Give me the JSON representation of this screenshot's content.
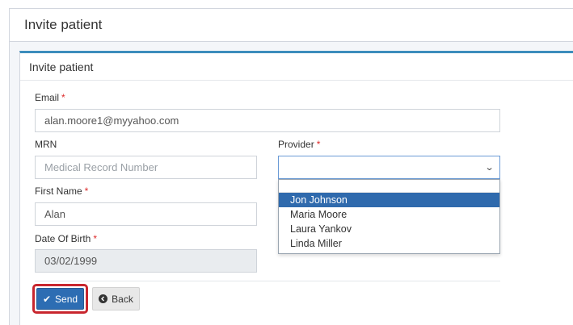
{
  "page": {
    "title": "Invite patient"
  },
  "panel": {
    "title": "Invite patient"
  },
  "form": {
    "email": {
      "label": "Email",
      "required_mark": "*",
      "value": "alan.moore1@myyahoo.com"
    },
    "mrn": {
      "label": "MRN",
      "placeholder": "Medical Record Number"
    },
    "provider": {
      "label": "Provider",
      "required_mark": "*",
      "value": "",
      "options": [
        "Jon Johnson",
        "Maria Moore",
        "Laura Yankov",
        "Linda Miller"
      ],
      "highlighted_option": "Jon Johnson"
    },
    "first_name": {
      "label": "First Name",
      "required_mark": "*",
      "value": "Alan"
    },
    "dob": {
      "label": "Date Of Birth",
      "required_mark": "*",
      "value": "03/02/1999"
    }
  },
  "actions": {
    "send_label": "Send",
    "back_label": "Back"
  },
  "colors": {
    "accent": "#2d6db3",
    "required": "#dd2c2c",
    "highlight_border": "#c8262e",
    "selected_option": "#2f6aad"
  },
  "icons": {
    "send": "check-icon",
    "back": "circle-arrow-left-icon",
    "select": "chevron-down-icon"
  }
}
